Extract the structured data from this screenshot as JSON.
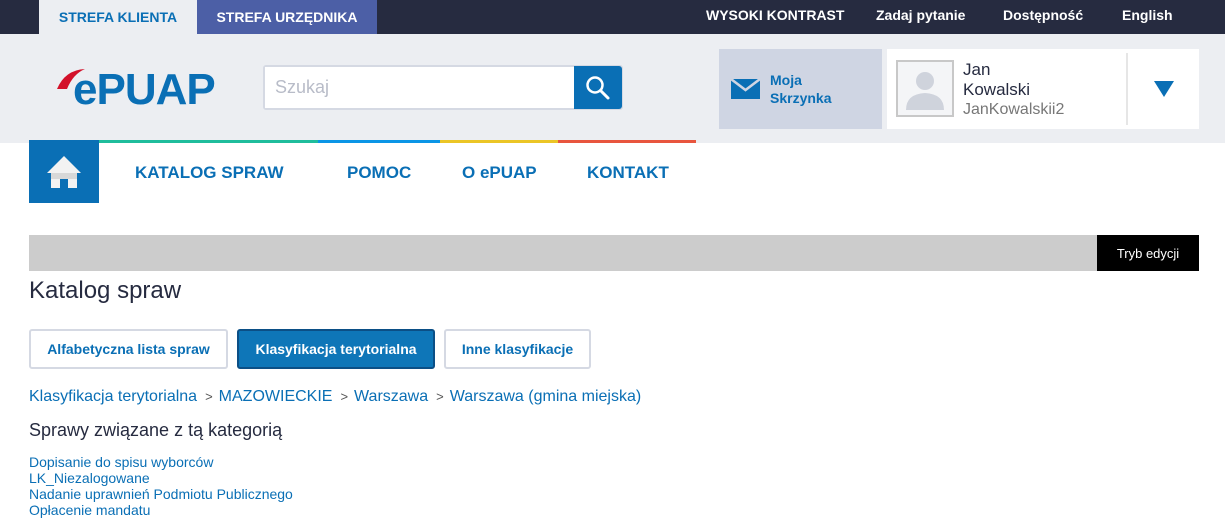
{
  "topbar": {
    "zones": [
      {
        "label": "STREFA KLIENTA",
        "active": true
      },
      {
        "label": "STREFA URZĘDNIKA",
        "active": false
      }
    ],
    "links": [
      "WYSOKI KONTRAST",
      "Zadaj pytanie",
      "Dostępność",
      "English"
    ]
  },
  "header": {
    "logo": "ePUAP",
    "search_placeholder": "Szukaj",
    "mailbox": [
      "Moja",
      "Skrzynka"
    ],
    "user": {
      "first_name": "Jan",
      "last_name": "Kowalski",
      "login": "JanKowalskii2"
    }
  },
  "nav": [
    "KATALOG SPRAW",
    "POMOC",
    "O ePUAP",
    "KONTAKT"
  ],
  "colors": {
    "accent": "#0a6fb5",
    "stripe": [
      "#1fbd9c",
      "#0a95e6",
      "#ebc526",
      "#e8553e"
    ]
  },
  "edit_mode": "Tryb edycji",
  "page_title": "Katalog spraw",
  "tabs": [
    {
      "label": "Alfabetyczna lista spraw",
      "active": false
    },
    {
      "label": "Klasyfikacja terytorialna",
      "active": true
    },
    {
      "label": "Inne klasyfikacje",
      "active": false
    }
  ],
  "breadcrumb": [
    "Klasyfikacja terytorialna",
    "MAZOWIECKIE",
    "Warszawa",
    "Warszawa (gmina miejska)"
  ],
  "breadcrumb_sep": ">",
  "section_title": "Sprawy związane z tą kategorią",
  "cases": [
    "Dopisanie do spisu wyborców",
    "LK_Niezalogowane",
    "Nadanie uprawnień Podmiotu Publicznego",
    "Opłacenie mandatu"
  ]
}
